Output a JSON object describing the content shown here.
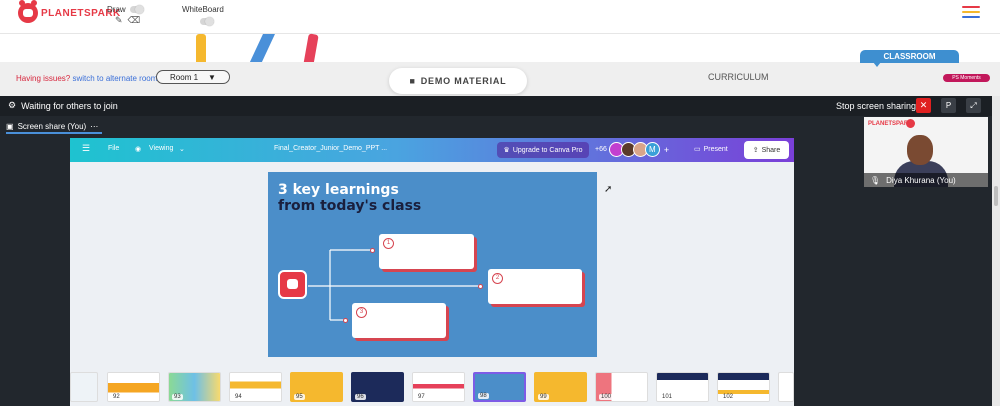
{
  "app": {
    "logo_text": "PLANETSPARK"
  },
  "toolbar": {
    "draw_label": "Draw",
    "whiteboard_label": "WhiteBoard",
    "hamburger_colors": [
      "#e63946",
      "#f5b82e",
      "#3a6fd8"
    ]
  },
  "nav": {
    "classroom_tab": "CLASSROOM",
    "issue_text": "Having issues?",
    "alternate_room_link": "switch to alternate room",
    "room_select": "Room 1",
    "demo_material": "DEMO MATERIAL",
    "curriculum": "CURRICULUM",
    "ps_moments": "PS Moments"
  },
  "meeting": {
    "status": "Waiting for others to join",
    "stop_sharing": "Stop screen sharing",
    "p_button": "P",
    "share_tab_label": "Screen share (You)",
    "participant_name": "Diya Khurana (You)",
    "participant_logo": "PLANETSPARK"
  },
  "canva": {
    "file_menu": "File",
    "viewing": "Viewing",
    "doc_title": "Final_Creator_Junior_Demo_PPT ...",
    "upgrade": "Upgrade to Canva Pro",
    "collab_count": "+66",
    "collab_initial": "M",
    "present": "Present",
    "share": "Share",
    "slide": {
      "title_line1": "3 key learnings",
      "title_line2": "from today's class",
      "card_numbers": [
        "1",
        "2",
        "3"
      ]
    },
    "thumbnails": [
      "92",
      "93",
      "94",
      "95",
      "96",
      "97",
      "98",
      "99",
      "100",
      "101",
      "102"
    ],
    "active_thumbnail": "98"
  },
  "colors": {
    "brand_red": "#e63946",
    "accent_blue": "#3e8fd0",
    "stop_red": "#e02020",
    "slide_blue": "#4b8ec9"
  }
}
